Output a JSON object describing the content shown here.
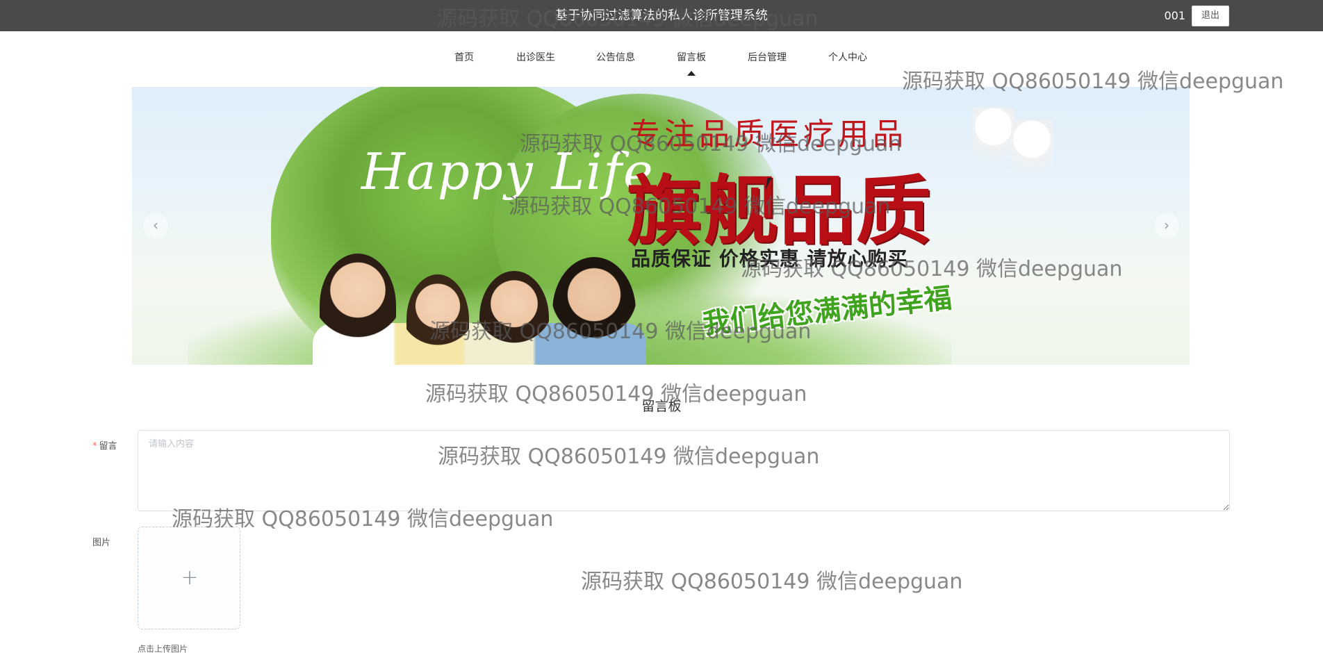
{
  "header": {
    "title": "基于协同过滤算法的私人诊所管理系统",
    "username": "001",
    "logout_label": "退出"
  },
  "nav": {
    "items": [
      {
        "label": "首页"
      },
      {
        "label": "出诊医生"
      },
      {
        "label": "公告信息"
      },
      {
        "label": "留言板"
      },
      {
        "label": "后台管理"
      },
      {
        "label": "个人中心"
      }
    ],
    "active_index": 3
  },
  "banner": {
    "slogan_top": "专注品质医疗用品",
    "slogan_main": "旗舰品质",
    "slogan_sub": "品质保证 价格实惠 请放心购买",
    "slogan_happy": "我们给您满满的幸福",
    "art_text": "Happy Life",
    "prev_icon": "‹",
    "next_icon": "›"
  },
  "section": {
    "title": "留言板"
  },
  "form": {
    "message": {
      "label": "留言",
      "required_mark": "*",
      "placeholder": "请输入内容",
      "value": ""
    },
    "image": {
      "label": "图片",
      "upload_icon": "+",
      "tip": "点击上传图片"
    }
  },
  "watermark": {
    "text": "源码获取 QQ86050149 微信deepguan"
  },
  "colors": {
    "topbar": "#4a4a4a",
    "required": "#f56c6c",
    "banner_red": "#b80f16",
    "banner_green": "#3fa31d"
  }
}
